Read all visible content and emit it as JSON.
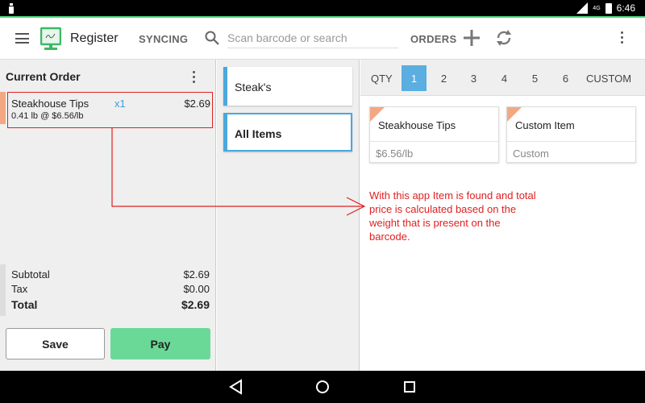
{
  "status_bar": {
    "network": "4G",
    "time": "6:46"
  },
  "app_bar": {
    "title": "Register",
    "sync_label": "SYNCING",
    "search_placeholder": "Scan barcode or search",
    "orders_label": "ORDERS"
  },
  "order": {
    "title": "Current Order",
    "items": [
      {
        "name": "Steakhouse Tips",
        "qty": "x1",
        "price": "$2.69",
        "detail": "0.41 lb @ $6.56/lb"
      }
    ],
    "subtotal_label": "Subtotal",
    "subtotal": "$2.69",
    "tax_label": "Tax",
    "tax": "$0.00",
    "total_label": "Total",
    "total": "$2.69",
    "save_label": "Save",
    "pay_label": "Pay"
  },
  "categories": [
    {
      "label": "Steak's",
      "active": false
    },
    {
      "label": "All Items",
      "active": true
    }
  ],
  "quantity": {
    "label": "QTY",
    "options": [
      "1",
      "2",
      "3",
      "4",
      "5",
      "6"
    ],
    "selected": "1",
    "custom_label": "CUSTOM"
  },
  "items": [
    {
      "name": "Steakhouse Tips",
      "sub": "$6.56/lb"
    },
    {
      "name": "Custom Item",
      "sub": "Custom"
    }
  ],
  "annotation": "With this app Item is found and total price is calculated based on the weight that is present on the barcode.",
  "colors": {
    "accent": "#4aa8dc",
    "pay": "#6ad998",
    "annotation": "#e02020",
    "item_corner": "#f4a882"
  }
}
